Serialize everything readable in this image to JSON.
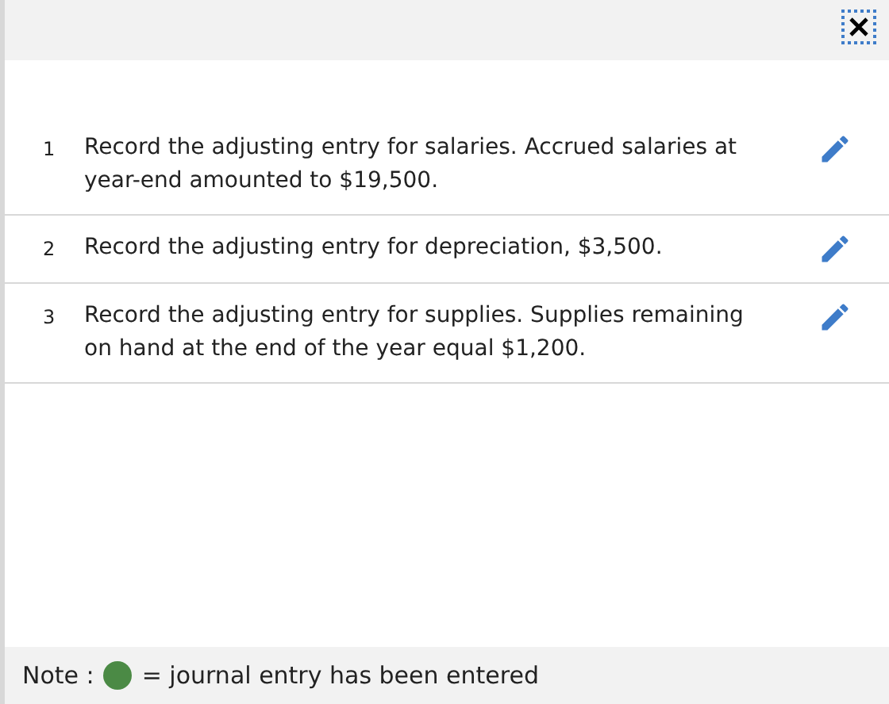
{
  "entries": [
    {
      "number": "1",
      "text": "Record the adjusting entry for salaries. Accrued salaries at year-end amounted to $19,500."
    },
    {
      "number": "2",
      "text": "Record the adjusting entry for depreciation, $3,500."
    },
    {
      "number": "3",
      "text": "Record the adjusting entry for supplies. Supplies remaining on hand at the end of the year equal $1,200."
    }
  ],
  "note": {
    "label": "Note :",
    "color": "#4b8a45",
    "text": "= journal entry has been entered"
  }
}
